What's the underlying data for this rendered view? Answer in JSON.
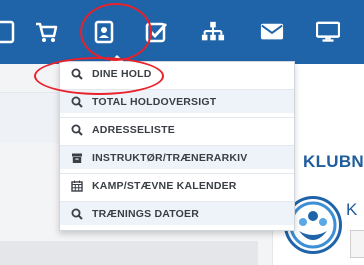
{
  "toolbar": {
    "icons": [
      "tablet-icon",
      "shopping-cart-icon",
      "id-badge-icon",
      "checkbox-icon",
      "sitemap-icon",
      "envelope-icon",
      "monitor-icon"
    ],
    "active_icon": "id-badge-icon",
    "color": "#1f63a9"
  },
  "dropdown": {
    "items": [
      {
        "label": "DINE HOLD",
        "icon": "search-icon",
        "highlighted": true
      },
      {
        "label": "TOTAL HOLDOVERSIGT",
        "icon": "search-icon"
      },
      {
        "label": "ADRESSELISTE",
        "icon": "search-icon"
      },
      {
        "label": "INSTRUKTØR/TRÆNERARKIV",
        "icon": "archive-icon"
      },
      {
        "label": "KAMP/STÆVNE KALENDER",
        "icon": "calendar-icon"
      },
      {
        "label": "TRÆNINGS DATOER",
        "icon": "search-icon"
      }
    ]
  },
  "club": {
    "title": "KLUBN",
    "name_initial": "K"
  },
  "annotation_color": "#e8212a"
}
